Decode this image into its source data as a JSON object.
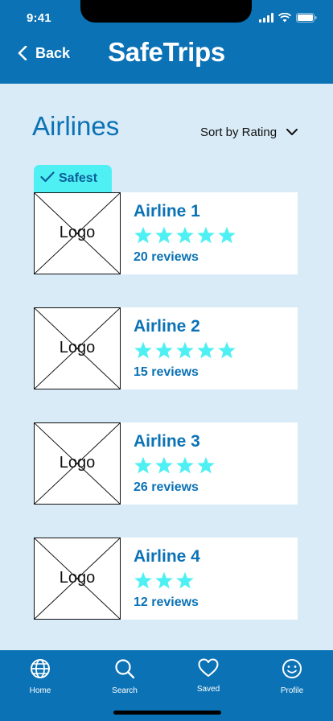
{
  "status": {
    "time": "9:41"
  },
  "header": {
    "back_label": "Back",
    "title": "SafeTrips"
  },
  "page": {
    "title": "Airlines",
    "sort_label": "Sort by Rating"
  },
  "badge": {
    "label": "Safest"
  },
  "airlines": [
    {
      "name": "Airline 1",
      "logo_placeholder": "Logo",
      "rating": 5,
      "reviews": "20 reviews"
    },
    {
      "name": "Airline 2",
      "logo_placeholder": "Logo",
      "rating": 5,
      "reviews": "15 reviews"
    },
    {
      "name": "Airline 3",
      "logo_placeholder": "Logo",
      "rating": 4,
      "reviews": "26 reviews"
    },
    {
      "name": "Airline 4",
      "logo_placeholder": "Logo",
      "rating": 3,
      "reviews": "12 reviews"
    }
  ],
  "tabs": [
    {
      "label": "Home",
      "icon": "globe-icon"
    },
    {
      "label": "Search",
      "icon": "search-icon"
    },
    {
      "label": "Saved",
      "icon": "heart-icon"
    },
    {
      "label": "Profile",
      "icon": "smiley-icon"
    }
  ],
  "colors": {
    "brand": "#0b72b5",
    "background": "#d8ebf7",
    "star": "#4ff0f3",
    "badge": "#4ff0f3"
  }
}
